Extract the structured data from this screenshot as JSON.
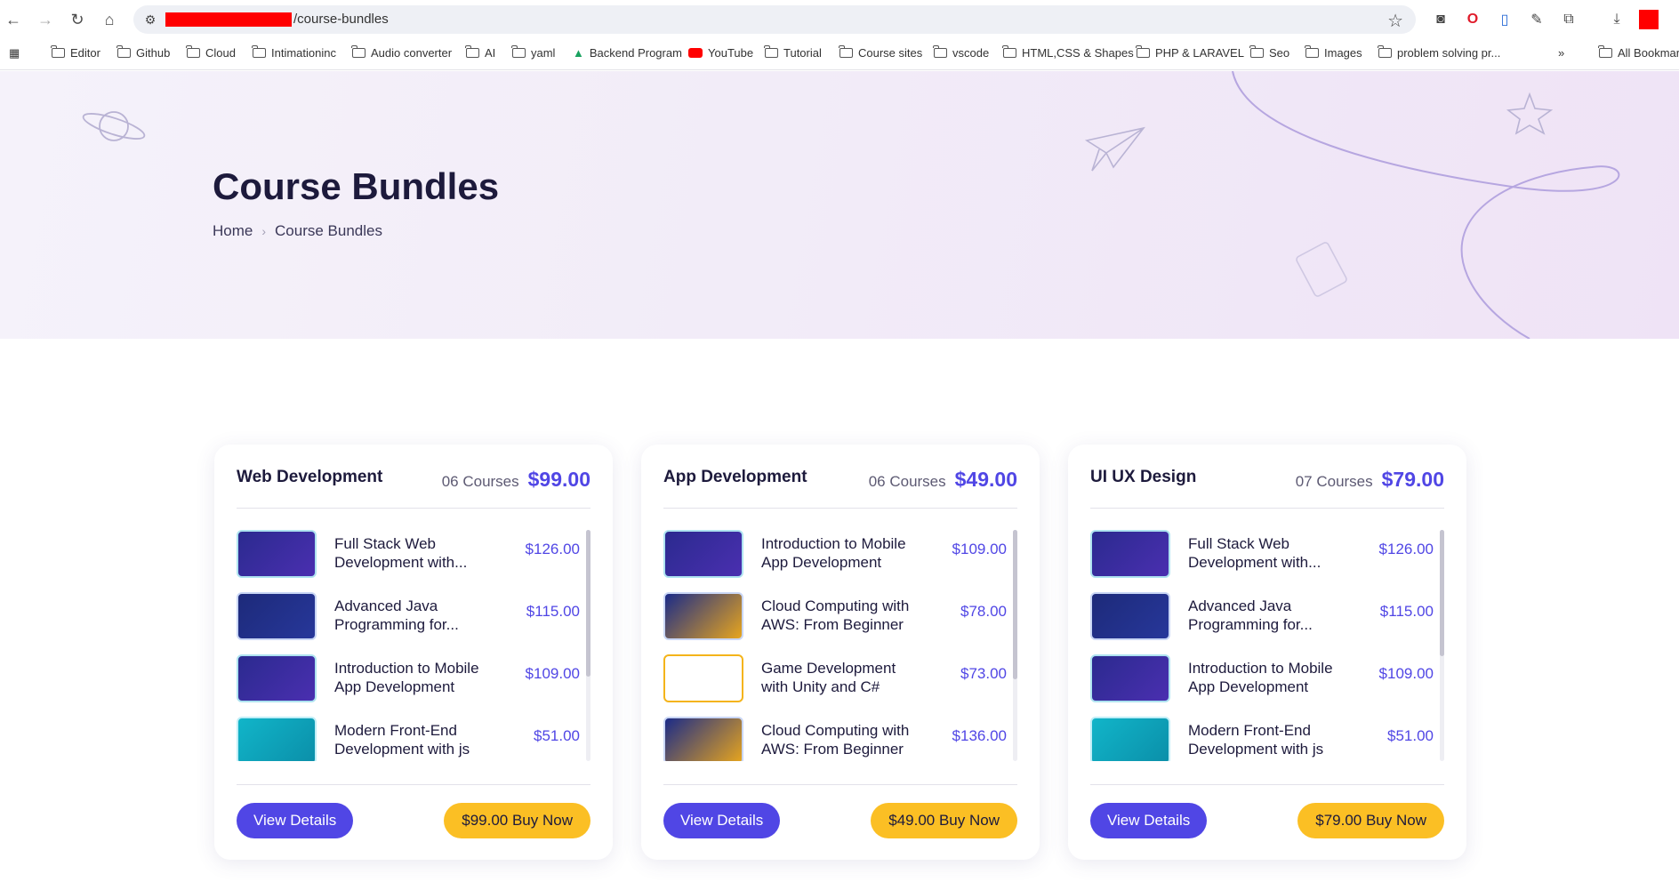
{
  "browser": {
    "url_path": "/course-bundles",
    "bookmarks": [
      "Editor",
      "Github",
      "Cloud",
      "Intimationinc",
      "Audio converter",
      "AI",
      "yaml",
      "Backend Program",
      "YouTube",
      "Tutorial",
      "Course sites",
      "vscode",
      "HTML,CSS & Shapes",
      "PHP & LARAVEL",
      "Seo",
      "Images",
      "problem solving pr...",
      "All Bookmar"
    ]
  },
  "hero": {
    "title": "Course Bundles",
    "breadcrumb": {
      "home": "Home",
      "current": "Course Bundles"
    }
  },
  "cards": [
    {
      "title": "Web Development",
      "count": "06 Courses",
      "price": "$99.00",
      "view_label": "View Details",
      "buy_label": "$99.00 Buy Now",
      "items": [
        {
          "title": "Full Stack Web Development with...",
          "price": "$126.00",
          "thumb": "purple"
        },
        {
          "title": "Advanced Java Programming for...",
          "price": "$115.00",
          "thumb": "navy"
        },
        {
          "title": "Introduction to Mobile App Development",
          "price": "$109.00",
          "thumb": "purple"
        },
        {
          "title": "Modern Front-End Development with js",
          "price": "$51.00",
          "thumb": "cyan"
        }
      ]
    },
    {
      "title": "App Development",
      "count": "06 Courses",
      "price": "$49.00",
      "view_label": "View Details",
      "buy_label": "$49.00 Buy Now",
      "items": [
        {
          "title": "Introduction to Mobile App Development",
          "price": "$109.00",
          "thumb": "purple"
        },
        {
          "title": "Cloud Computing with AWS: From Beginner",
          "price": "$78.00",
          "thumb": "sale"
        },
        {
          "title": "Game Development with Unity and C#",
          "price": "$73.00",
          "thumb": "yellow"
        },
        {
          "title": "Cloud Computing with AWS: From Beginner",
          "price": "$136.00",
          "thumb": "sale"
        }
      ]
    },
    {
      "title": "UI UX Design",
      "count": "07 Courses",
      "price": "$79.00",
      "view_label": "View Details",
      "buy_label": "$79.00 Buy Now",
      "items": [
        {
          "title": "Full Stack Web Development with...",
          "price": "$126.00",
          "thumb": "purple"
        },
        {
          "title": "Advanced Java Programming for...",
          "price": "$115.00",
          "thumb": "navy"
        },
        {
          "title": "Introduction to Mobile App Development",
          "price": "$109.00",
          "thumb": "purple"
        },
        {
          "title": "Modern Front-End Development with js",
          "price": "$51.00",
          "thumb": "cyan"
        }
      ]
    }
  ],
  "colors": {
    "accent": "#5046e5",
    "buy": "#fbbf24",
    "title": "#1d1a3c"
  }
}
